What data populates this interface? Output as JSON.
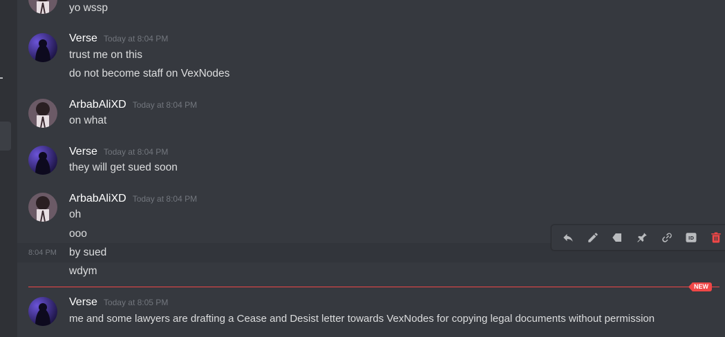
{
  "colors": {
    "background": "#36393f",
    "sidebar": "#2f3136",
    "username": "#ffffff",
    "timestamp": "#72767d",
    "text": "#dcddde",
    "new_divider": "#f04747",
    "delete_icon": "#f04747"
  },
  "messages": [
    {
      "author": "",
      "timestamp": "",
      "lines": [
        "yo wssp"
      ],
      "avatar": "arbab-avatar"
    },
    {
      "author": "Verse",
      "timestamp": "Today at 8:04 PM",
      "lines": [
        "trust me on this",
        "do not become staff on VexNodes"
      ],
      "avatar": "verse-avatar"
    },
    {
      "author": "ArbabAliXD",
      "timestamp": "Today at 8:04 PM",
      "lines": [
        "on what"
      ],
      "avatar": "arbab-avatar"
    },
    {
      "author": "Verse",
      "timestamp": "Today at 8:04 PM",
      "lines": [
        "they will get sued soon"
      ],
      "avatar": "verse-avatar"
    },
    {
      "author": "ArbabAliXD",
      "timestamp": "Today at 8:04 PM",
      "lines": [
        "oh",
        "ooo",
        "by sued",
        "wdym"
      ],
      "avatar": "arbab-avatar"
    },
    {
      "author": "Verse",
      "timestamp": "Today at 8:05 PM",
      "lines": [
        "me and some lawyers are drafting a Cease and Desist letter towards VexNodes for copying legal documents without permission"
      ],
      "avatar": "verse-avatar"
    }
  ],
  "hovered_line_timestamp": "8:04 PM",
  "new_badge": "NEW",
  "toolbar": {
    "icons": [
      "reply-icon",
      "edit-icon",
      "forward-icon",
      "pin-icon",
      "copy-link-icon",
      "copy-id-icon",
      "delete-icon"
    ],
    "id_label": "ID"
  }
}
